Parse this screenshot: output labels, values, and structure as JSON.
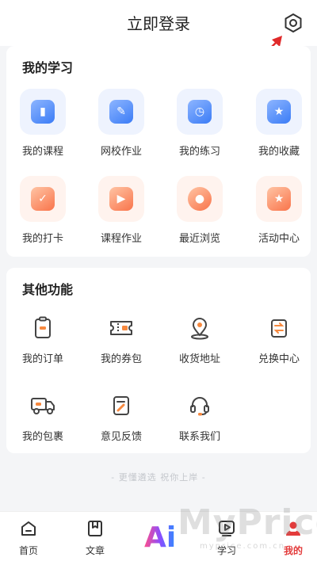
{
  "header": {
    "title": "立即登录",
    "settings_icon": "gear-icon"
  },
  "study": {
    "title": "我的学习",
    "items": [
      {
        "label": "我的课程",
        "icon": "course-icon"
      },
      {
        "label": "网校作业",
        "icon": "homework-icon"
      },
      {
        "label": "我的练习",
        "icon": "practice-icon"
      },
      {
        "label": "我的收藏",
        "icon": "favorite-icon"
      },
      {
        "label": "我的打卡",
        "icon": "checkin-icon"
      },
      {
        "label": "课程作业",
        "icon": "course-homework-icon"
      },
      {
        "label": "最近浏览",
        "icon": "recent-icon"
      },
      {
        "label": "活动中心",
        "icon": "activity-icon"
      }
    ]
  },
  "other": {
    "title": "其他功能",
    "items": [
      {
        "label": "我的订单",
        "icon": "order-icon"
      },
      {
        "label": "我的券包",
        "icon": "coupon-icon"
      },
      {
        "label": "收货地址",
        "icon": "location-icon"
      },
      {
        "label": "兑换中心",
        "icon": "exchange-icon"
      },
      {
        "label": "我的包裹",
        "icon": "truck-icon"
      },
      {
        "label": "意见反馈",
        "icon": "feedback-icon"
      },
      {
        "label": "联系我们",
        "icon": "headset-icon"
      }
    ]
  },
  "footer_note": "- 更懂遴选 祝你上岸 -",
  "tabbar": {
    "tabs": [
      {
        "label": "首页",
        "icon": "home-icon"
      },
      {
        "label": "文章",
        "icon": "bookmark-icon"
      },
      {
        "label": "学习",
        "icon": "video-icon"
      },
      {
        "label": "我的",
        "icon": "profile-icon"
      }
    ],
    "ai_label": "Ai",
    "active": "我的"
  },
  "watermark": {
    "text": "MyPrice",
    "sub": "myprice.com.cn"
  },
  "colors": {
    "accent": "#e33b3b",
    "blue": "#3b7cf6",
    "orange": "#f9744b",
    "arrow": "#e02a2a"
  }
}
